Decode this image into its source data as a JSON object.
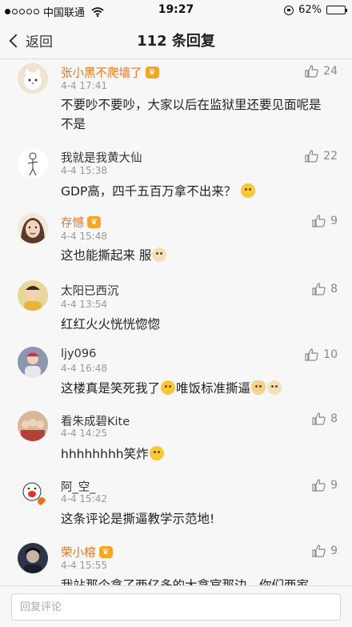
{
  "status_bar": {
    "carrier": "中国联通",
    "time": "19:27",
    "battery": "62%",
    "battery_level": 0.62
  },
  "nav": {
    "back_label": "返回",
    "title": "112 条回复"
  },
  "replies": [
    {
      "name": "张小黑不爬墙了",
      "vip": true,
      "time": "4-4 17:41",
      "text": "不要吵不要吵，大家以后在监狱里还要见面呢是不是",
      "likes": "24",
      "avatar": "cat-avatar",
      "avatar_color": "#e9d8c4"
    },
    {
      "name": "我就是我黄大仙",
      "vip": false,
      "time": "4-4 15:38",
      "text": "GDP高，四千五百万拿不出来？",
      "likes": "22",
      "avatar": "sketch-figure-avatar",
      "avatar_color": "#ffffff",
      "emoji_after": "upside-down-face-emoji"
    },
    {
      "name": "存憾",
      "vip": true,
      "time": "4-4 15:48",
      "text": "这也能撕起来  服",
      "likes": "9",
      "avatar": "woman-portrait-avatar",
      "avatar_color": "#d7b08c",
      "emoji_after": "dog-emoji"
    },
    {
      "name": "太阳已西沉",
      "vip": false,
      "time": "4-4 13:54",
      "text": "红红火火恍恍惚惚",
      "likes": "8",
      "avatar": "child-photo-avatar",
      "avatar_color": "#e8c86a"
    },
    {
      "name": "ljy096",
      "vip": false,
      "time": "4-4 16:48",
      "text_parts": [
        "这楼真是笑死我了",
        "唯饭标准撕逼"
      ],
      "likes": "10",
      "avatar": "person-photo-avatar",
      "avatar_color": "#7f8fa6"
    },
    {
      "name": "看朱成碧Kite",
      "vip": false,
      "time": "4-4 14:25",
      "text": "hhhhhhhh笑炸",
      "likes": "8",
      "avatar": "group-photo-avatar",
      "avatar_color": "#c98f6e",
      "emoji_after": "laughing-emoji"
    },
    {
      "name": "阿_空_",
      "vip": false,
      "time": "4-4 15:42",
      "text": "这条评论是撕逼教学示范地!",
      "likes": "9",
      "avatar": "cartoon-avatar",
      "avatar_color": "#f2f2f2"
    },
    {
      "name": "荣小榕",
      "vip": true,
      "time": "4-4 15:55",
      "text": "我站那个拿了两亿多的大拿官那边，你们两家",
      "likes": "9",
      "avatar": "dark-portrait-avatar",
      "avatar_color": "#2e3548"
    }
  ],
  "composer": {
    "placeholder": "回复评论"
  }
}
